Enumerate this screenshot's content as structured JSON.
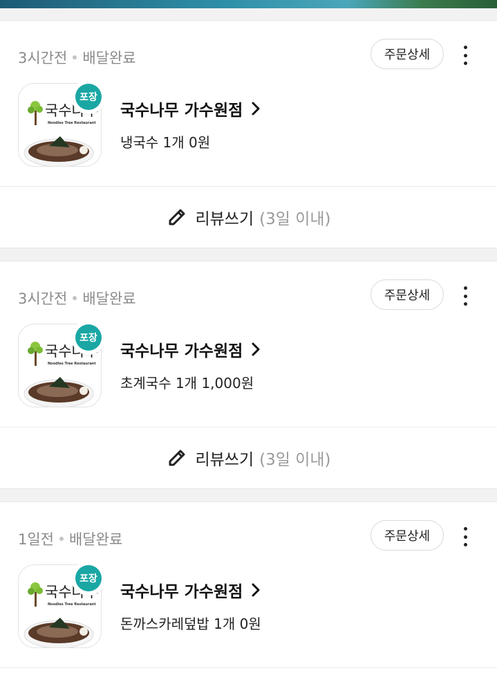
{
  "orders": [
    {
      "time": "3시간전",
      "status": "배달완료",
      "detail_label": "주문상세",
      "badge": "포장",
      "store": "국수나무 가수원점",
      "items": "냉국수 1개 0원",
      "review_label": "리뷰쓰기",
      "review_hint": "(3일 이내)",
      "logo_text": "국수나무",
      "logo_sub": "Noodles Tree Restaurant"
    },
    {
      "time": "3시간전",
      "status": "배달완료",
      "detail_label": "주문상세",
      "badge": "포장",
      "store": "국수나무 가수원점",
      "items": "초계국수 1개 1,000원",
      "review_label": "리뷰쓰기",
      "review_hint": "(3일 이내)",
      "logo_text": "국수나무",
      "logo_sub": "Noodles Tree Restaurant"
    },
    {
      "time": "1일전",
      "status": "배달완료",
      "detail_label": "주문상세",
      "badge": "포장",
      "store": "국수나무 가수원점",
      "items": "돈까스카레덮밥 1개 0원",
      "logo_text": "국수나무",
      "logo_sub": "Noodles Tree Restaurant"
    }
  ],
  "icons": {
    "more": "more-vertical-icon",
    "chevron": "chevron-right-icon",
    "pencil": "pencil-icon"
  },
  "colors": {
    "badge": "#1aa7a4",
    "meta_text": "#8a8a8a",
    "background": "#f2f2f2"
  }
}
